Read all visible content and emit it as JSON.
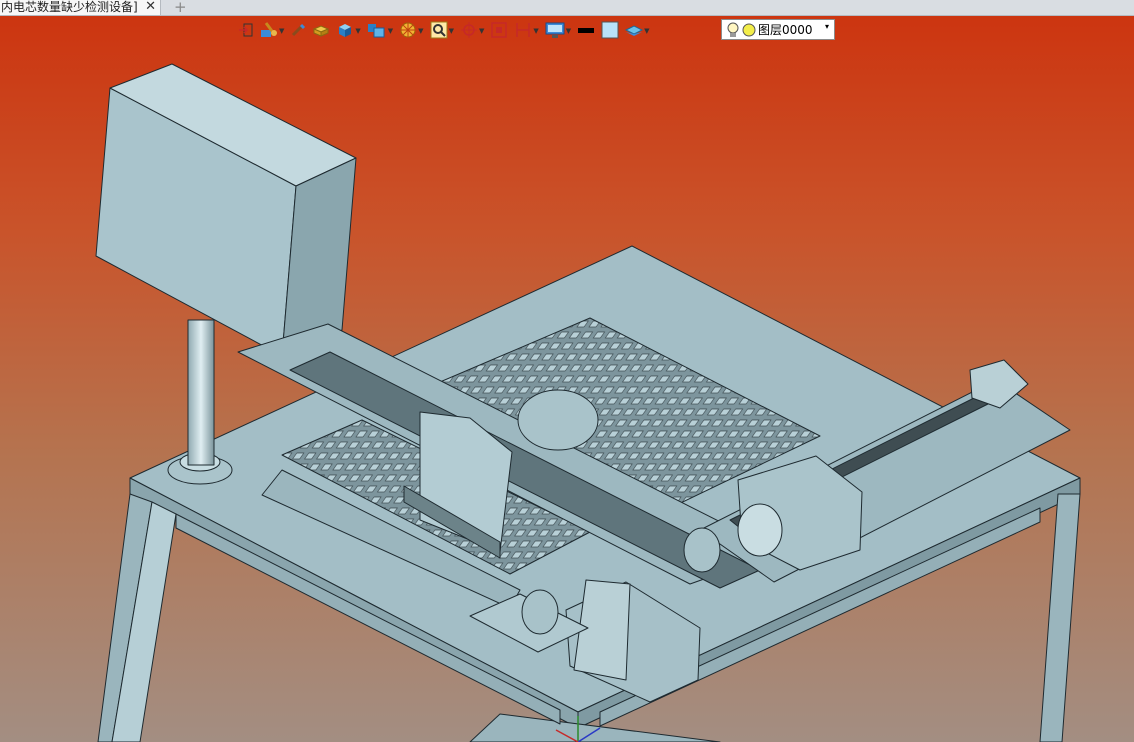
{
  "tab": {
    "title": "内电芯数量缺少检测设备]",
    "close_glyph": "✕",
    "new_glyph": "+"
  },
  "toolbar": {
    "icons": [
      "exit-icon",
      "sketch-icon",
      "pen-icon",
      "cake-icon",
      "cube-icon",
      "multi-cube-icon",
      "orange-icon",
      "zoom-icon",
      "crosshair-icon",
      "fit-icon",
      "dimension-icon",
      "monitor-icon",
      "line-color-icon",
      "fill-color-icon",
      "layer-stack-icon"
    ],
    "layer": {
      "name": "图层0000",
      "dropdown_glyph": "▾",
      "bulb_icon": "bulb-icon",
      "dot_color": "#f3ee4a"
    }
  },
  "colors": {
    "model_fill": "#a7c3cb",
    "model_stroke": "#1e2a30",
    "background_top": "#cc3510",
    "background_bottom": "#a38e82"
  }
}
